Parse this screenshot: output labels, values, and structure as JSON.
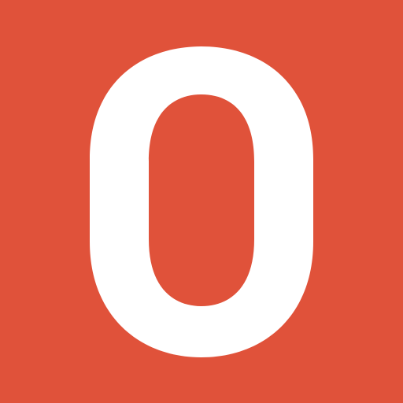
{
  "colors": {
    "background": "#E0523A",
    "glyph": "#FFFFFF"
  },
  "glyph": {
    "text": "0"
  }
}
